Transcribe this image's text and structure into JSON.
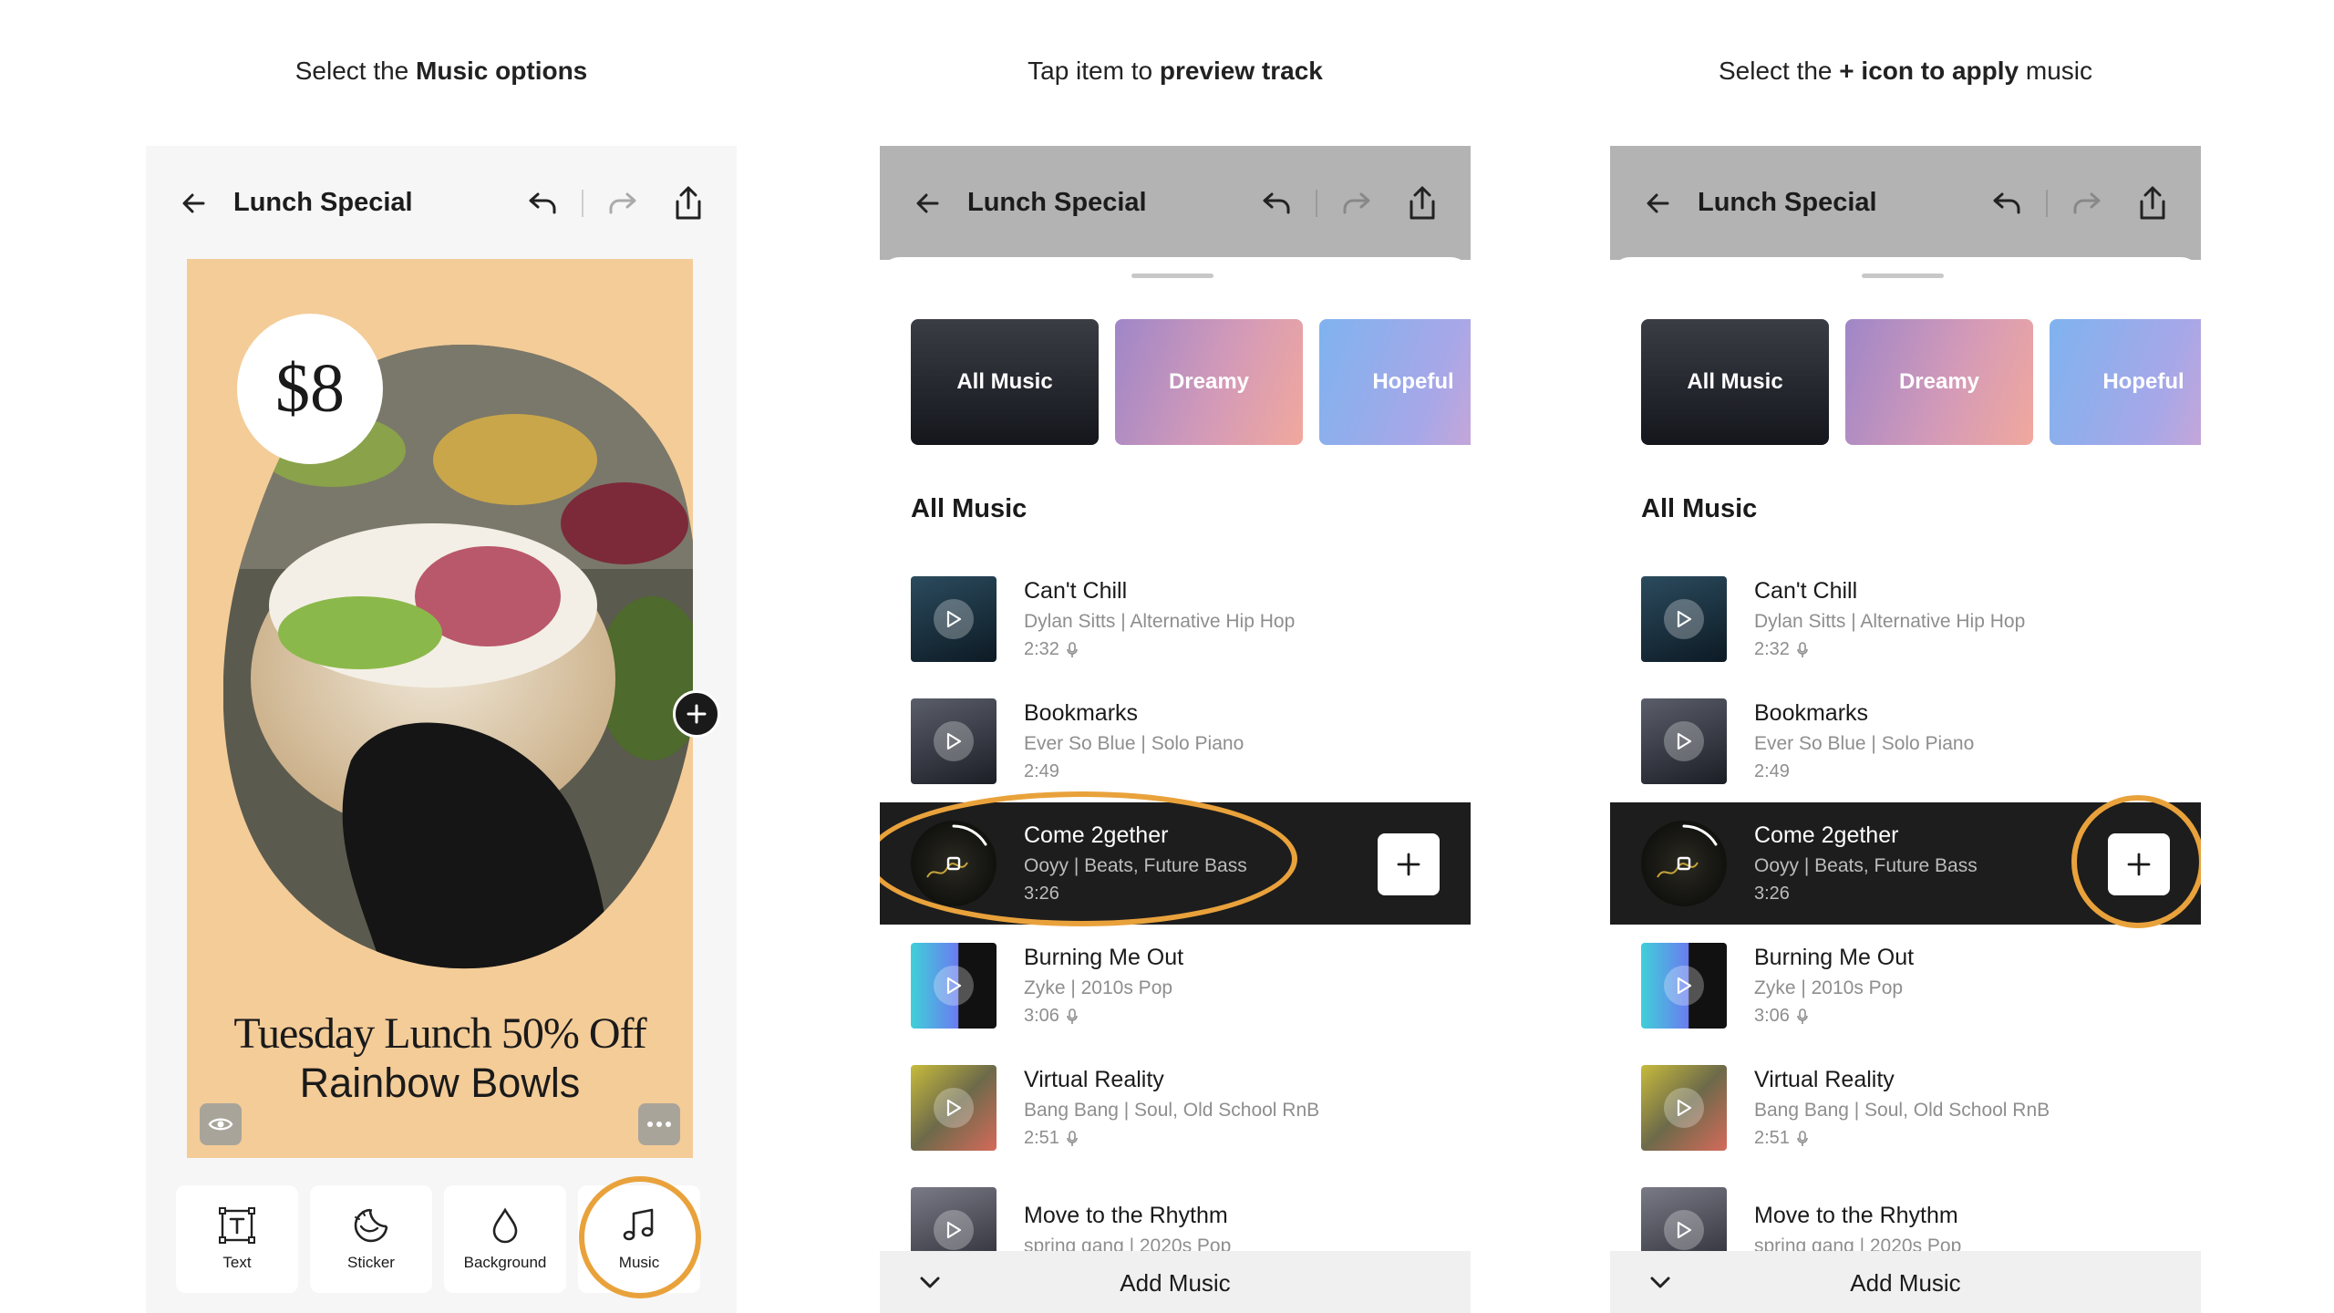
{
  "captions": [
    {
      "prefix": "Select the ",
      "bold": "Music options",
      "suffix": ""
    },
    {
      "prefix": "Tap item to ",
      "bold": "preview track",
      "suffix": ""
    },
    {
      "prefix": "Select the ",
      "bold": "+ icon to apply",
      "suffix": " music"
    }
  ],
  "app": {
    "title": "Lunch Special"
  },
  "canvas": {
    "price": "$8",
    "headline_line1": "Tuesday Lunch 50% Off",
    "headline_line2": "Rainbow Bowls",
    "background_color": "#f4cc98"
  },
  "toolbar": {
    "items": [
      {
        "label": "Text",
        "icon": "text-box-icon"
      },
      {
        "label": "Sticker",
        "icon": "sticker-icon"
      },
      {
        "label": "Background",
        "icon": "drop-icon"
      },
      {
        "label": "Music",
        "icon": "music-note-icon"
      }
    ]
  },
  "music": {
    "categories": [
      "All Music",
      "Dreamy",
      "Hopeful"
    ],
    "section_title": "All Music",
    "tracks": [
      {
        "title": "Can't Chill",
        "artist_genre": "Dylan Sitts | Alternative Hip Hop",
        "duration": "2:32",
        "vocals": true
      },
      {
        "title": "Bookmarks",
        "artist_genre": "Ever So Blue | Solo Piano",
        "duration": "2:49",
        "vocals": false
      },
      {
        "title": "Come 2gether",
        "artist_genre": "Ooyy | Beats, Future Bass",
        "duration": "3:26",
        "vocals": false,
        "active": true
      },
      {
        "title": "Burning Me Out",
        "artist_genre": "Zyke | 2010s Pop",
        "duration": "3:06",
        "vocals": true
      },
      {
        "title": "Virtual Reality",
        "artist_genre": "Bang Bang | Soul, Old School RnB",
        "duration": "2:51",
        "vocals": true
      },
      {
        "title": "Move to the Rhythm",
        "artist_genre": "spring gang | 2020s Pop",
        "duration": "",
        "vocals": false
      }
    ],
    "add_music_label": "Add Music"
  },
  "colors": {
    "highlight_ring": "#e9a23b",
    "active_row": "#1d1d1d",
    "canvas_bg": "#f4cc98"
  }
}
